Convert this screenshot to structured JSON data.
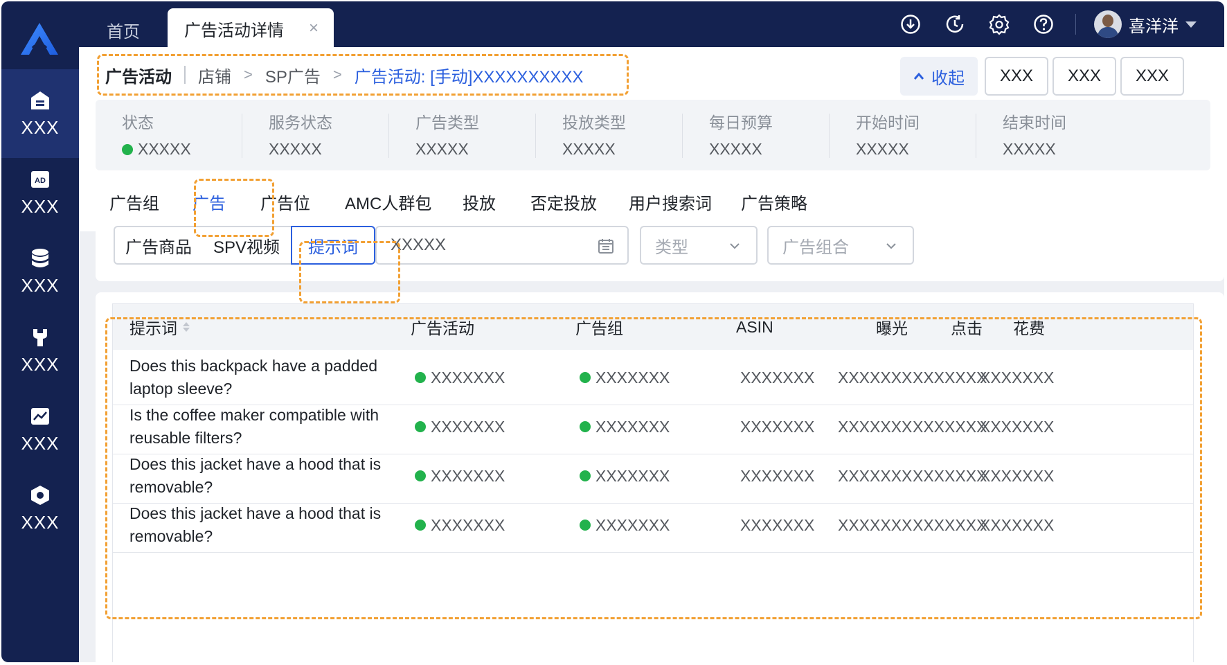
{
  "sidebar": {
    "items": [
      {
        "label": "XXX",
        "icon": "home-icon",
        "active": true
      },
      {
        "label": "XXX",
        "icon": "ad-icon",
        "active": false
      },
      {
        "label": "XXX",
        "icon": "database-icon",
        "active": false
      },
      {
        "label": "XXX",
        "icon": "wrench-icon",
        "active": false
      },
      {
        "label": "XXX",
        "icon": "chart-icon",
        "active": false
      },
      {
        "label": "XXX",
        "icon": "hexagon-settings-icon",
        "active": false
      }
    ]
  },
  "topbar": {
    "home_tab": "首页",
    "active_tab": "广告活动详情",
    "close_glyph": "×",
    "icons": [
      "download-icon",
      "history-icon",
      "settings-icon",
      "help-icon"
    ],
    "user_name": "喜洋洋"
  },
  "breadcrumb": {
    "root": "广告活动",
    "items": [
      "店铺",
      "SP广告"
    ],
    "current": "广告活动: [手动]XXXXXXXXXX"
  },
  "actions": {
    "collapse_label": "收起",
    "buttons": [
      "XXX",
      "XXX",
      "XXX"
    ]
  },
  "info": [
    {
      "label": "状态",
      "value": "XXXXX",
      "status_color": "#22b24c"
    },
    {
      "label": "服务状态",
      "value": "XXXXX"
    },
    {
      "label": "广告类型",
      "value": "XXXXX"
    },
    {
      "label": "投放类型",
      "value": "XXXXX"
    },
    {
      "label": "每日预算",
      "value": "XXXXX"
    },
    {
      "label": "开始时间",
      "value": "XXXXX"
    },
    {
      "label": "结束时间",
      "value": "XXXXX"
    }
  ],
  "tabs": [
    "广告组",
    "广告",
    "广告位",
    "AMC人群包",
    "投放",
    "否定投放",
    "用户搜索词",
    "广告策略"
  ],
  "active_tab_index": 1,
  "filters": {
    "segments": [
      "广告商品",
      "SPV视频",
      "提示词"
    ],
    "active_segment": "提示词",
    "date_value": "XXXXX",
    "type_placeholder": "类型",
    "group_placeholder": "广告组合"
  },
  "table": {
    "columns": [
      "提示词",
      "广告活动",
      "广告组",
      "ASIN",
      "曝光",
      "点击",
      "花费"
    ],
    "rows": [
      {
        "prompt_line1": "Does this backpack have a padded",
        "prompt_line2": "laptop sleeve?",
        "campaign": "XXXXXXX",
        "ad_group": "XXXXXXX",
        "asin": "XXXXXXX",
        "impressions": "XXXXXXX",
        "clicks": "XXXXXXX",
        "spend": "XXXXXXX"
      },
      {
        "prompt_line1": "Is the coffee maker compatible with",
        "prompt_line2": "reusable filters?",
        "campaign": "XXXXXXX",
        "ad_group": "XXXXXXX",
        "asin": "XXXXXXX",
        "impressions": "XXXXXXX",
        "clicks": "XXXXXXX",
        "spend": "XXXXXXX"
      },
      {
        "prompt_line1": "Does this jacket have a hood that is",
        "prompt_line2": "removable?",
        "campaign": "XXXXXXX",
        "ad_group": "XXXXXXX",
        "asin": "XXXXXXX",
        "impressions": "XXXXXXX",
        "clicks": "XXXXXXX",
        "spend": "XXXXXXX"
      },
      {
        "prompt_line1": "Does this jacket have a hood that is",
        "prompt_line2": "removable?",
        "campaign": "XXXXXXX",
        "ad_group": "XXXXXXX",
        "asin": "XXXXXXX",
        "impressions": "XXXXXXX",
        "clicks": "XXXXXXX",
        "spend": "XXXXXXX"
      }
    ]
  },
  "colors": {
    "sidebar_bg": "#142250",
    "accent": "#2b5fde",
    "highlight": "#f2a033",
    "status_green": "#22b24c"
  }
}
